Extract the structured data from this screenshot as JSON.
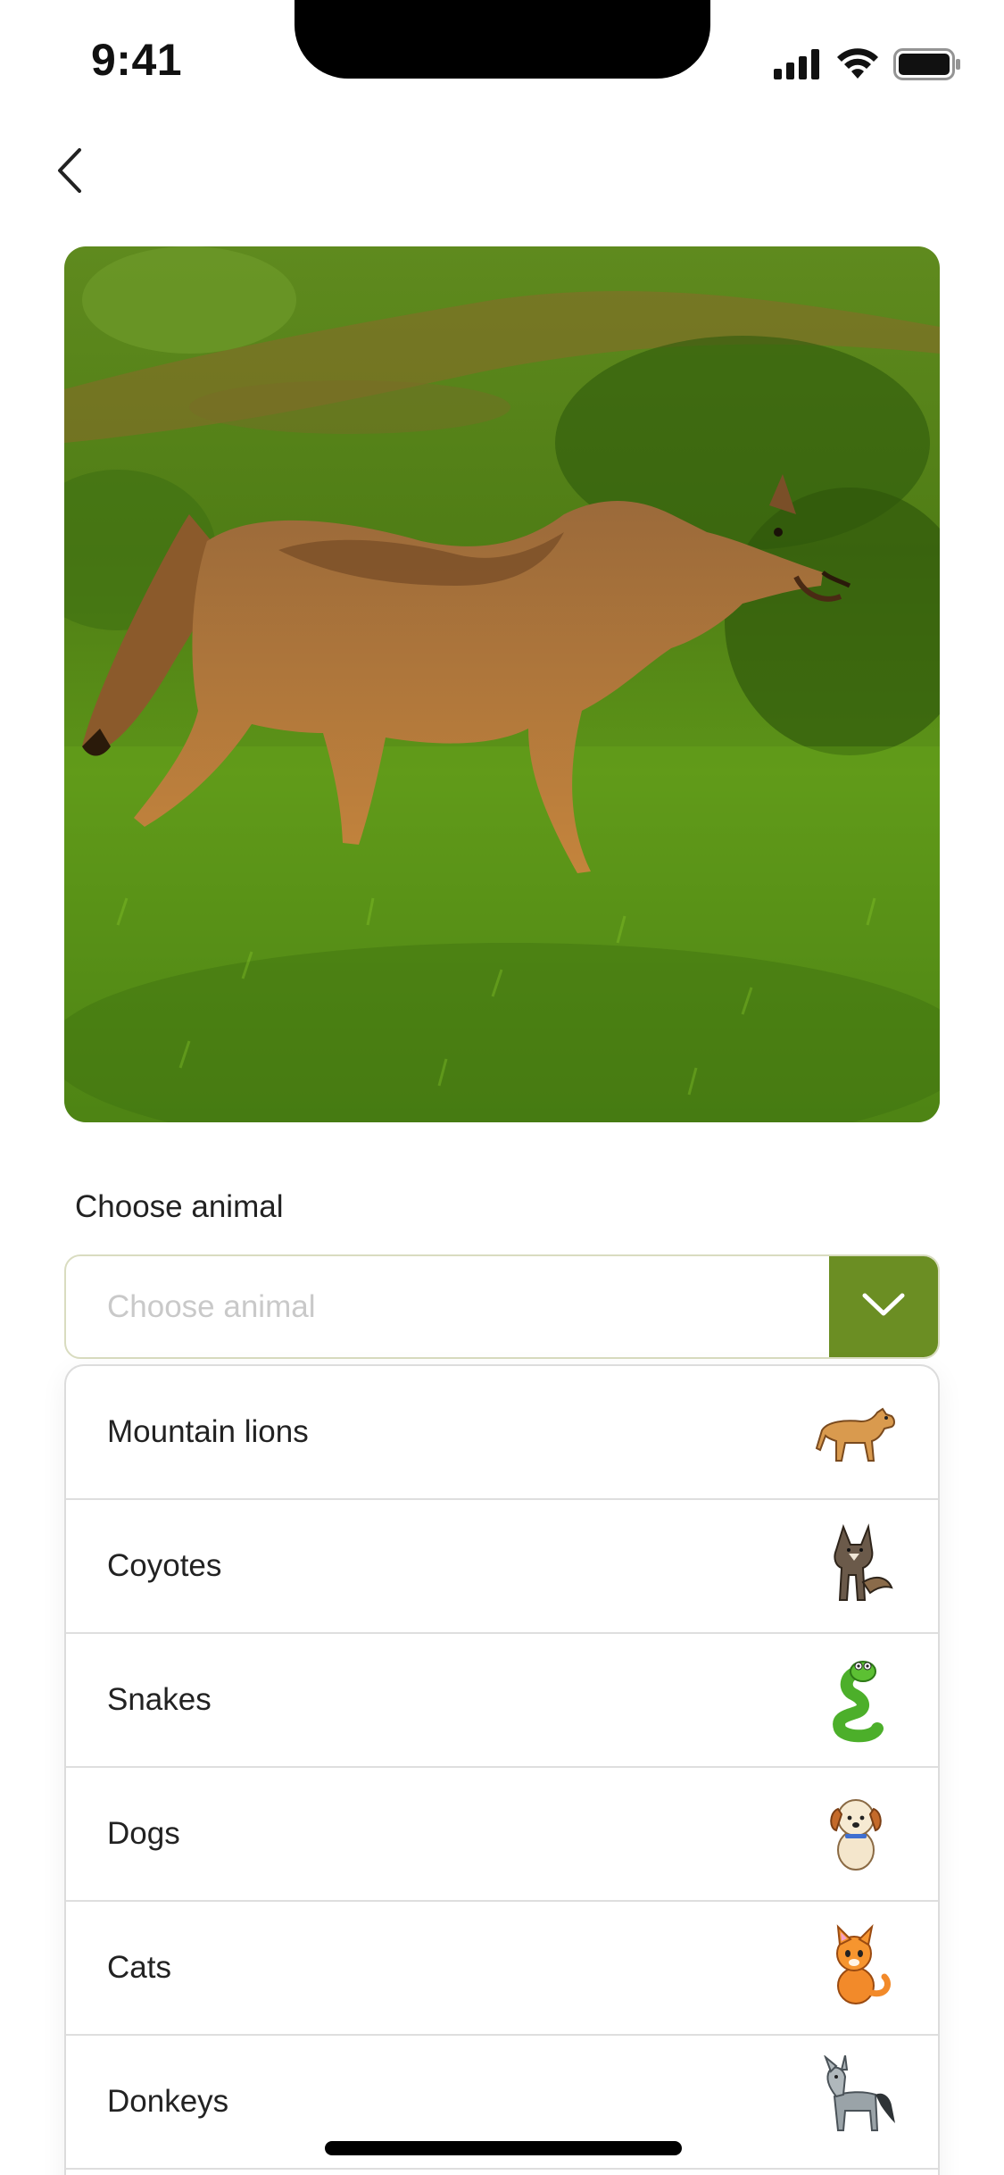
{
  "status_bar": {
    "time": "9:41"
  },
  "header": {
    "back_icon": "chevron-left-icon"
  },
  "photo": {
    "subject": "coyote-photo"
  },
  "form": {
    "label": "Choose animal",
    "select": {
      "placeholder": "Choose animal",
      "toggle_icon": "chevron-down-icon"
    }
  },
  "dropdown": {
    "options": [
      {
        "label": "Mountain lions",
        "icon": "mountain-lion-icon"
      },
      {
        "label": "Coyotes",
        "icon": "coyote-icon"
      },
      {
        "label": "Snakes",
        "icon": "snake-icon"
      },
      {
        "label": "Dogs",
        "icon": "dog-icon"
      },
      {
        "label": "Cats",
        "icon": "cat-icon"
      },
      {
        "label": "Donkeys",
        "icon": "donkey-icon"
      }
    ]
  },
  "colors": {
    "accent": "#6b8e23",
    "border": "#d9dcc0",
    "placeholder": "#c9c9c9",
    "divider": "#dedede"
  }
}
